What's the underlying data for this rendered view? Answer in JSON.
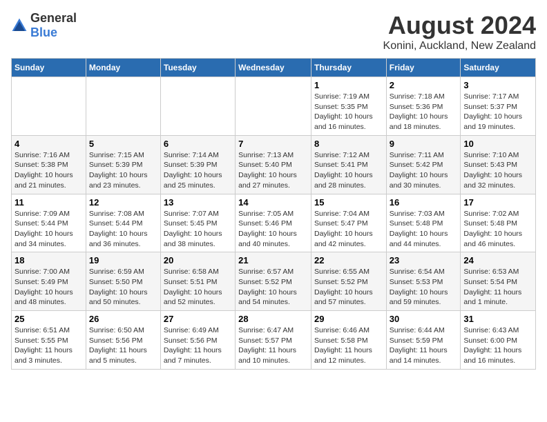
{
  "logo": {
    "general": "General",
    "blue": "Blue"
  },
  "title": "August 2024",
  "subtitle": "Konini, Auckland, New Zealand",
  "days_of_week": [
    "Sunday",
    "Monday",
    "Tuesday",
    "Wednesday",
    "Thursday",
    "Friday",
    "Saturday"
  ],
  "weeks": [
    [
      {
        "day": "",
        "content": ""
      },
      {
        "day": "",
        "content": ""
      },
      {
        "day": "",
        "content": ""
      },
      {
        "day": "",
        "content": ""
      },
      {
        "day": "1",
        "content": "Sunrise: 7:19 AM\nSunset: 5:35 PM\nDaylight: 10 hours\nand 16 minutes."
      },
      {
        "day": "2",
        "content": "Sunrise: 7:18 AM\nSunset: 5:36 PM\nDaylight: 10 hours\nand 18 minutes."
      },
      {
        "day": "3",
        "content": "Sunrise: 7:17 AM\nSunset: 5:37 PM\nDaylight: 10 hours\nand 19 minutes."
      }
    ],
    [
      {
        "day": "4",
        "content": "Sunrise: 7:16 AM\nSunset: 5:38 PM\nDaylight: 10 hours\nand 21 minutes."
      },
      {
        "day": "5",
        "content": "Sunrise: 7:15 AM\nSunset: 5:39 PM\nDaylight: 10 hours\nand 23 minutes."
      },
      {
        "day": "6",
        "content": "Sunrise: 7:14 AM\nSunset: 5:39 PM\nDaylight: 10 hours\nand 25 minutes."
      },
      {
        "day": "7",
        "content": "Sunrise: 7:13 AM\nSunset: 5:40 PM\nDaylight: 10 hours\nand 27 minutes."
      },
      {
        "day": "8",
        "content": "Sunrise: 7:12 AM\nSunset: 5:41 PM\nDaylight: 10 hours\nand 28 minutes."
      },
      {
        "day": "9",
        "content": "Sunrise: 7:11 AM\nSunset: 5:42 PM\nDaylight: 10 hours\nand 30 minutes."
      },
      {
        "day": "10",
        "content": "Sunrise: 7:10 AM\nSunset: 5:43 PM\nDaylight: 10 hours\nand 32 minutes."
      }
    ],
    [
      {
        "day": "11",
        "content": "Sunrise: 7:09 AM\nSunset: 5:44 PM\nDaylight: 10 hours\nand 34 minutes."
      },
      {
        "day": "12",
        "content": "Sunrise: 7:08 AM\nSunset: 5:44 PM\nDaylight: 10 hours\nand 36 minutes."
      },
      {
        "day": "13",
        "content": "Sunrise: 7:07 AM\nSunset: 5:45 PM\nDaylight: 10 hours\nand 38 minutes."
      },
      {
        "day": "14",
        "content": "Sunrise: 7:05 AM\nSunset: 5:46 PM\nDaylight: 10 hours\nand 40 minutes."
      },
      {
        "day": "15",
        "content": "Sunrise: 7:04 AM\nSunset: 5:47 PM\nDaylight: 10 hours\nand 42 minutes."
      },
      {
        "day": "16",
        "content": "Sunrise: 7:03 AM\nSunset: 5:48 PM\nDaylight: 10 hours\nand 44 minutes."
      },
      {
        "day": "17",
        "content": "Sunrise: 7:02 AM\nSunset: 5:48 PM\nDaylight: 10 hours\nand 46 minutes."
      }
    ],
    [
      {
        "day": "18",
        "content": "Sunrise: 7:00 AM\nSunset: 5:49 PM\nDaylight: 10 hours\nand 48 minutes."
      },
      {
        "day": "19",
        "content": "Sunrise: 6:59 AM\nSunset: 5:50 PM\nDaylight: 10 hours\nand 50 minutes."
      },
      {
        "day": "20",
        "content": "Sunrise: 6:58 AM\nSunset: 5:51 PM\nDaylight: 10 hours\nand 52 minutes."
      },
      {
        "day": "21",
        "content": "Sunrise: 6:57 AM\nSunset: 5:52 PM\nDaylight: 10 hours\nand 54 minutes."
      },
      {
        "day": "22",
        "content": "Sunrise: 6:55 AM\nSunset: 5:52 PM\nDaylight: 10 hours\nand 57 minutes."
      },
      {
        "day": "23",
        "content": "Sunrise: 6:54 AM\nSunset: 5:53 PM\nDaylight: 10 hours\nand 59 minutes."
      },
      {
        "day": "24",
        "content": "Sunrise: 6:53 AM\nSunset: 5:54 PM\nDaylight: 11 hours\nand 1 minute."
      }
    ],
    [
      {
        "day": "25",
        "content": "Sunrise: 6:51 AM\nSunset: 5:55 PM\nDaylight: 11 hours\nand 3 minutes."
      },
      {
        "day": "26",
        "content": "Sunrise: 6:50 AM\nSunset: 5:56 PM\nDaylight: 11 hours\nand 5 minutes."
      },
      {
        "day": "27",
        "content": "Sunrise: 6:49 AM\nSunset: 5:56 PM\nDaylight: 11 hours\nand 7 minutes."
      },
      {
        "day": "28",
        "content": "Sunrise: 6:47 AM\nSunset: 5:57 PM\nDaylight: 11 hours\nand 10 minutes."
      },
      {
        "day": "29",
        "content": "Sunrise: 6:46 AM\nSunset: 5:58 PM\nDaylight: 11 hours\nand 12 minutes."
      },
      {
        "day": "30",
        "content": "Sunrise: 6:44 AM\nSunset: 5:59 PM\nDaylight: 11 hours\nand 14 minutes."
      },
      {
        "day": "31",
        "content": "Sunrise: 6:43 AM\nSunset: 6:00 PM\nDaylight: 11 hours\nand 16 minutes."
      }
    ]
  ]
}
